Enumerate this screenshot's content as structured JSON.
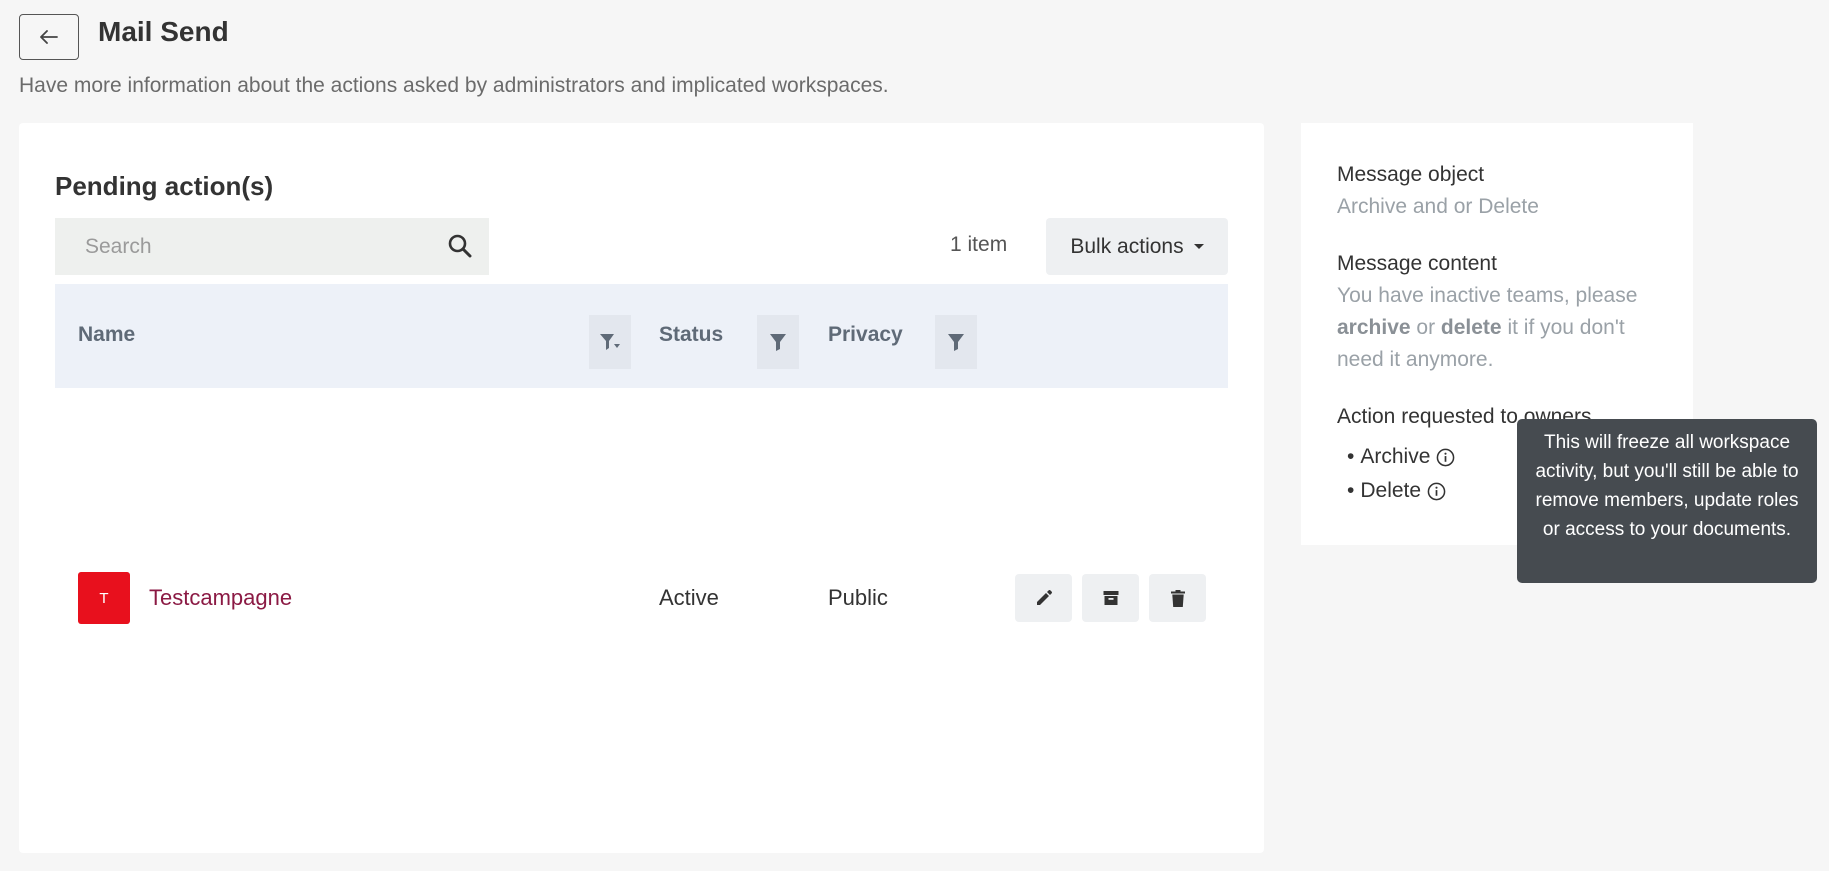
{
  "header": {
    "back_icon": "arrow-left-icon",
    "title": "Mail Send",
    "description": "Have more information about the actions asked by administrators and implicated workspaces."
  },
  "pending": {
    "title": "Pending action(s)",
    "search_placeholder": "Search",
    "search_value": "",
    "item_count": "1 item",
    "bulk_actions_label": "Bulk actions",
    "columns": [
      {
        "label": "Name",
        "filter_icon": "filter-sort-icon"
      },
      {
        "label": "Status",
        "filter_icon": "filter-icon"
      },
      {
        "label": "Privacy",
        "filter_icon": "filter-icon"
      }
    ],
    "rows": [
      {
        "avatar_letter": "T",
        "avatar_color": "#e8101d",
        "name": "Testcampagne",
        "status": "Active",
        "privacy": "Public",
        "actions": [
          "edit-icon",
          "archive-icon",
          "delete-icon"
        ]
      }
    ]
  },
  "details": {
    "object_label": "Message object",
    "object_value": "Archive and or Delete",
    "content_label": "Message content",
    "content_parts": [
      "You have inactive teams, please ",
      "archive",
      " or ",
      "delete",
      " it if you don't need it anymore."
    ],
    "action_label": "Action requested to owners",
    "actions": [
      {
        "label": "Archive",
        "icon": "info-icon"
      },
      {
        "label": "Delete",
        "icon": "info-icon"
      }
    ]
  },
  "tooltip": {
    "text": "This will freeze all workspace activity, but you'll still be able to remove members, update roles or access to your documents."
  },
  "colors": {
    "accent_name": "#8b1a44",
    "table_header_bg": "#edf1f8",
    "tooltip_bg": "#464b50"
  }
}
